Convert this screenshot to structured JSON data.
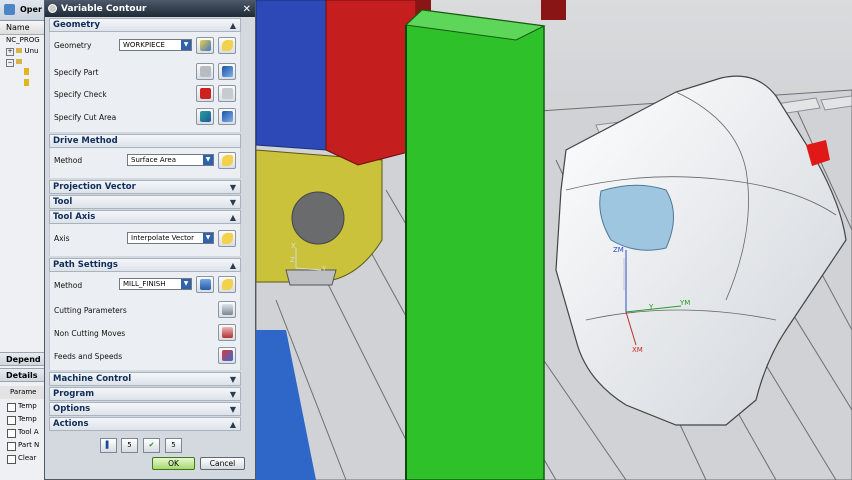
{
  "navigator": {
    "title": "Oper",
    "column_name": "Name",
    "rows": [
      "NC_PROG",
      "Unu",
      "",
      "",
      ""
    ],
    "dependencies_label": "Depend",
    "details_label": "Details",
    "param_header": "Parame",
    "param_rows": [
      "Temp",
      "Temp",
      "Tool A",
      "Part N",
      "Clear"
    ]
  },
  "dialog": {
    "title": "Variable Contour",
    "geometry": {
      "header": "Geometry",
      "geometry_label": "Geometry",
      "geometry_value": "WORKPIECE",
      "specify_part": "Specify Part",
      "specify_check": "Specify Check",
      "specify_cut_area": "Specify Cut Area"
    },
    "drive_method": {
      "header": "Drive Method",
      "method_label": "Method",
      "method_value": "Surface Area"
    },
    "projection_vector": "Projection Vector",
    "tool": "Tool",
    "tool_axis": {
      "header": "Tool Axis",
      "axis_label": "Axis",
      "axis_value": "Interpolate Vector"
    },
    "path_settings": {
      "header": "Path Settings",
      "method_label": "Method",
      "method_value": "MILL_FINISH",
      "cutting_parameters": "Cutting Parameters",
      "non_cutting_moves": "Non Cutting Moves",
      "feeds_and_speeds": "Feeds and Speeds"
    },
    "machine_control": "Machine Control",
    "program": "Program",
    "options": "Options",
    "actions": "Actions",
    "action_buttons": [
      "",
      "5",
      "",
      "5"
    ],
    "ok_label": "OK",
    "cancel_label": "Cancel"
  },
  "viewport": {
    "axes_left": {
      "x": "X",
      "y": "Y",
      "z": "Z"
    },
    "axes_part": {
      "zm": "ZM",
      "ym": "YM",
      "y": "Y",
      "xm": "XM"
    }
  },
  "colors": {
    "accent_title": "#1f2a36",
    "group_header_text": "#102e5a",
    "green_tool": "#2fc12a",
    "red_block": "#c41e1e",
    "blue_block": "#2d49b8",
    "yellow_holder": "#c9c23a"
  }
}
